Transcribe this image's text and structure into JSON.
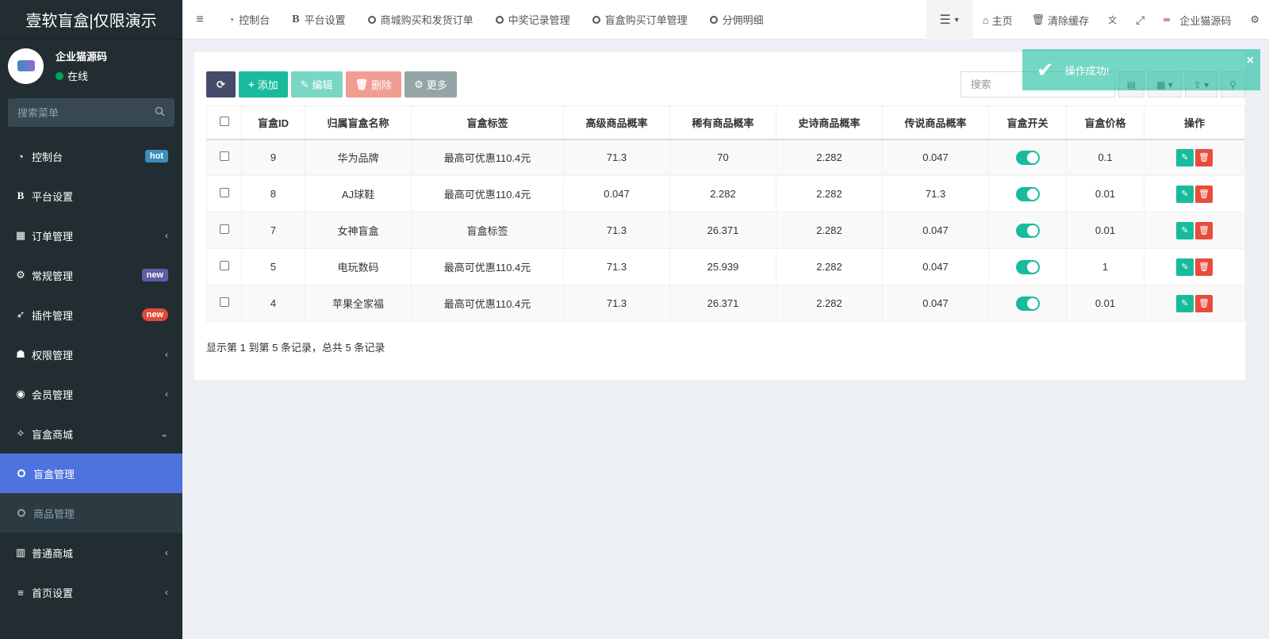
{
  "brand": "壹软盲盒|仅限演示",
  "user": {
    "name": "企业猫源码",
    "status": "在线"
  },
  "sidebar_search_placeholder": "搜索菜单",
  "menu": [
    {
      "label": "控制台",
      "icon": "dashboard-icon",
      "badge": "hot"
    },
    {
      "label": "平台设置",
      "icon": "bold-b-icon"
    },
    {
      "label": "订单管理",
      "icon": "calculator-icon"
    },
    {
      "label": "常规管理",
      "icon": "cogs-icon",
      "badge": "new"
    },
    {
      "label": "插件管理",
      "icon": "rocket-icon",
      "badge": "new"
    },
    {
      "label": "权限管理",
      "icon": "group-icon"
    },
    {
      "label": "会员管理",
      "icon": "user-circle-icon"
    },
    {
      "label": "盲盒商城",
      "icon": "paw-icon"
    }
  ],
  "submenu": [
    {
      "label": "盲盒管理"
    },
    {
      "label": "商品管理"
    }
  ],
  "menu_after": [
    {
      "label": "普通商城",
      "icon": "bank-icon"
    },
    {
      "label": "首页设置",
      "icon": "bars-icon"
    }
  ],
  "tabs": [
    "控制台",
    "平台设置",
    "商城购买和发货订单",
    "中奖记录管理",
    "盲盒购买订单管理",
    "分佣明细"
  ],
  "top_right": {
    "home": "主页",
    "clear_cache": "清除缓存",
    "account": "企业猫源码"
  },
  "toolbar": {
    "add": "添加",
    "edit": "编辑",
    "delete": "删除",
    "more": "更多"
  },
  "search_placeholder": "搜索",
  "table": {
    "headers": [
      "盲盒ID",
      "归属盲盒名称",
      "盲盒标签",
      "高级商品概率",
      "稀有商品概率",
      "史诗商品概率",
      "传说商品概率",
      "盲盒开关",
      "盲盒价格",
      "操作"
    ],
    "rows": [
      {
        "id": "9",
        "name": "华为品牌",
        "tag": "最高可优惠110.4元",
        "adv": "71.3",
        "rare": "70",
        "epic": "2.282",
        "legend": "0.047",
        "price": "0.1"
      },
      {
        "id": "8",
        "name": "AJ球鞋",
        "tag": "最高可优惠110.4元",
        "adv": "0.047",
        "rare": "2.282",
        "epic": "2.282",
        "legend": "71.3",
        "price": "0.01"
      },
      {
        "id": "7",
        "name": "女神盲盒",
        "tag": "盲盒标签",
        "adv": "71.3",
        "rare": "26.371",
        "epic": "2.282",
        "legend": "0.047",
        "price": "0.01"
      },
      {
        "id": "5",
        "name": "电玩数码",
        "tag": "最高可优惠110.4元",
        "adv": "71.3",
        "rare": "25.939",
        "epic": "2.282",
        "legend": "0.047",
        "price": "1"
      },
      {
        "id": "4",
        "name": "苹果全家福",
        "tag": "最高可优惠110.4元",
        "adv": "71.3",
        "rare": "26.371",
        "epic": "2.282",
        "legend": "0.047",
        "price": "0.01"
      }
    ]
  },
  "pager_text": "显示第 1 到第 5 条记录，总共 5 条记录",
  "toast": "操作成功!",
  "colors": {
    "accent": "#18bc9c",
    "sidebar": "#222d32",
    "active": "#4e73df",
    "danger": "#e74c3c"
  }
}
